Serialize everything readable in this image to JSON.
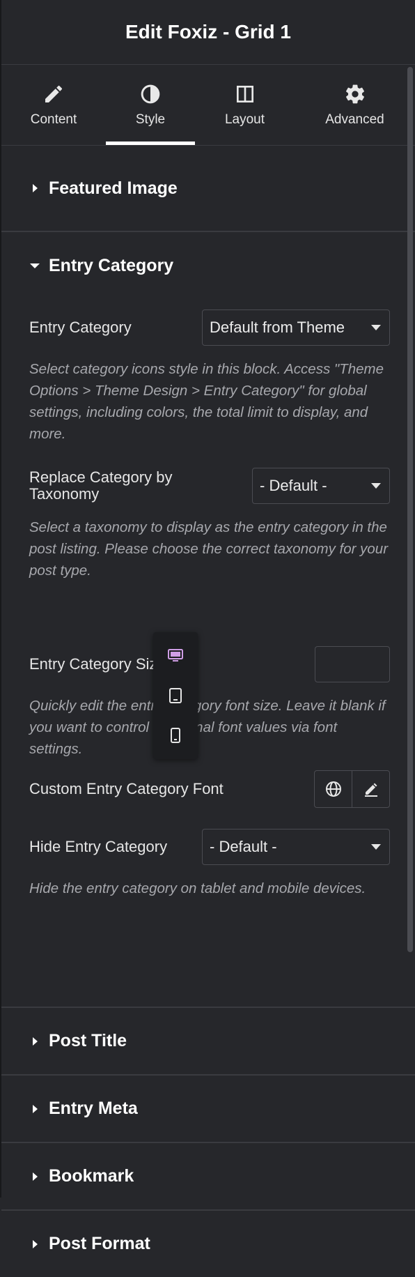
{
  "header": {
    "title": "Edit Foxiz - Grid 1"
  },
  "tabs": [
    {
      "label": "Content",
      "icon": "pencil-icon"
    },
    {
      "label": "Style",
      "icon": "contrast-icon",
      "active": true
    },
    {
      "label": "Layout",
      "icon": "columns-icon"
    },
    {
      "label": "Advanced",
      "icon": "gear-icon"
    }
  ],
  "sections": {
    "featured_image": {
      "title": "Featured Image"
    },
    "entry_category": {
      "title": "Entry Category",
      "fields": {
        "entry_category": {
          "label": "Entry Category",
          "value": "Default from Theme",
          "description": "Select category icons style in this block. Access \"Theme Options > Theme Design > Entry Category\" for global settings, including colors, the total limit to display, and more."
        },
        "replace_taxonomy": {
          "label": "Replace Category by Taxonomy",
          "value": "- Default -",
          "description": "Select a taxonomy to display as the entry category in the post listing. Please choose the correct taxonomy for your post type."
        },
        "category_size": {
          "label": "Entry Category Size",
          "value": "",
          "description": "Quickly edit the entry category font size. Leave it blank if you want to control additional font values via font settings."
        },
        "custom_font": {
          "label": "Custom Entry Category Font"
        },
        "hide_category": {
          "label": "Hide Entry Category",
          "value": "- Default -",
          "description": "Hide the entry category on tablet and mobile devices."
        }
      }
    },
    "post_title": {
      "title": "Post Title"
    },
    "entry_meta": {
      "title": "Entry Meta"
    },
    "bookmark": {
      "title": "Bookmark"
    },
    "post_format": {
      "title": "Post Format"
    }
  },
  "device_popup": {
    "active": "desktop",
    "accent_color": "#d09ee6"
  },
  "colors": {
    "background": "#26272b",
    "border": "#3a3b40",
    "text": "#e6e6e6",
    "muted": "#a7a8ad"
  }
}
